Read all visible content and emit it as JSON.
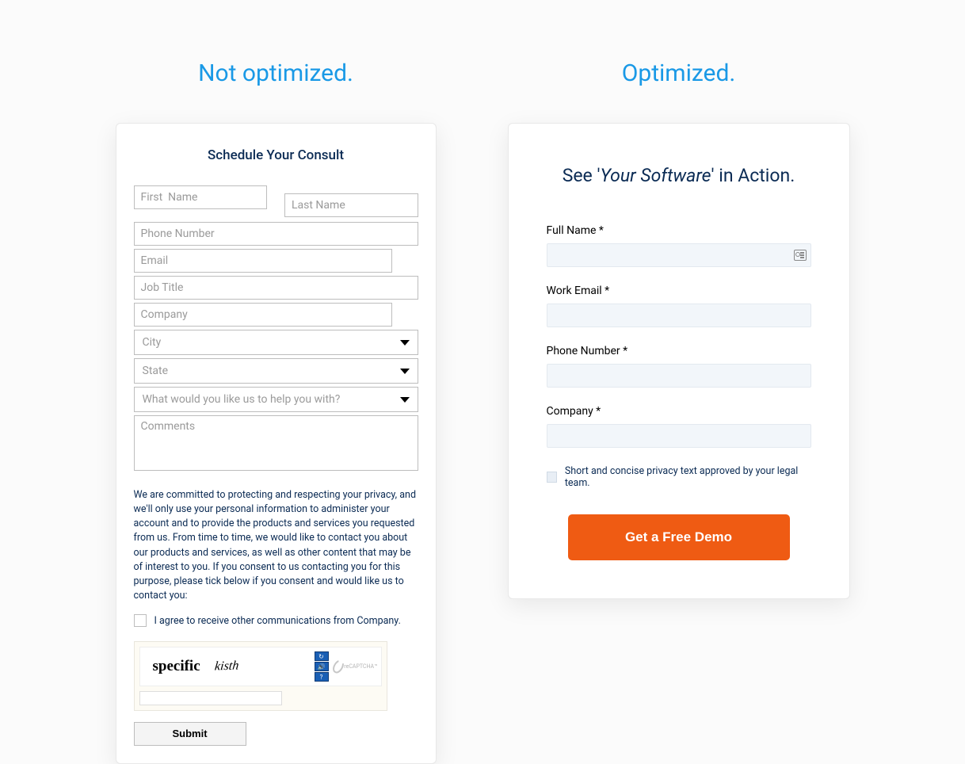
{
  "left": {
    "heading": "Not optimized.",
    "title": "Schedule Your Consult",
    "fields": {
      "first_name_ph": "First  Name",
      "last_name_ph": "Last Name",
      "phone_ph": "Phone Number",
      "email_ph": "Email",
      "job_title_ph": "Job Title",
      "company_ph": "Company",
      "city_ph": "City",
      "state_ph": "State",
      "help_ph": "What would you like us to help you with?",
      "comments_ph": "Comments"
    },
    "privacy": "We are committed to protecting and respecting your privacy, and we'll only use your personal information to administer your account and to provide the products and services you requested from us. From time to time, we would like to contact you about our products and services, as well as other content that may be of interest to you. If you consent to us contacting you for this purpose, please tick below if you consent and would like us to contact you:",
    "consent_label": "I agree to receive other communications from Company.",
    "captcha_word1": "specific",
    "captcha_word2": "kisth",
    "captcha_brand": "reCAPTCHA™",
    "submit_label": "Submit"
  },
  "right": {
    "heading": "Optimized.",
    "title_pre": "See '",
    "title_ital": "Your Software",
    "title_post": "' in Action.",
    "labels": {
      "full_name": "Full Name *",
      "work_email": "Work Email *",
      "phone": "Phone Number *",
      "company": "Company *"
    },
    "privacy_text": "Short and concise privacy text approved by your legal team.",
    "cta_label": "Get a Free Demo"
  }
}
